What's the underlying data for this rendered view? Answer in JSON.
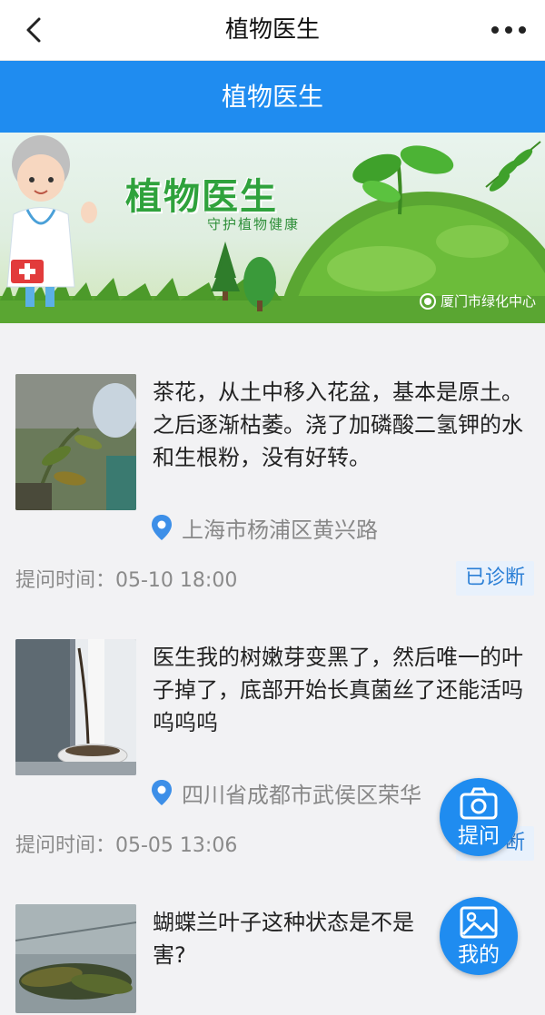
{
  "topnav": {
    "title": "植物医生",
    "back_icon": "chevron-left-icon",
    "more_icon": "more-dots-icon"
  },
  "header": {
    "title": "植物医生"
  },
  "banner": {
    "title": "植物医生",
    "subtitle": "守护植物健康",
    "org": "厦门市绿化中心"
  },
  "questions": [
    {
      "text": "茶花，从土中移入花盆，基本是原土。之后逐渐枯萎。浇了加磷酸二氢钾的水和生根粉，没有好转。",
      "location": "上海市杨浦区黄兴路",
      "time": "提问时间：05-10 18:00",
      "status": "已诊断"
    },
    {
      "text": "医生我的树嫩芽变黑了，然后唯一的叶子掉了，底部开始长真菌丝了还能活吗呜呜呜",
      "location": "四川省成都市武侯区荣华",
      "time": "提问时间：05-05 13:06",
      "status": "已诊断"
    },
    {
      "text": "蝴蝶兰叶子这种状态是不是",
      "text2": "害?"
    }
  ],
  "fabs": {
    "ask_label": "提问",
    "mine_label": "我的",
    "ask_icon": "camera-icon",
    "mine_icon": "image-icon"
  },
  "colors": {
    "brand_blue": "#1f8cf0",
    "status_bg": "#e8f1fc",
    "status_text": "#2b7fd6"
  }
}
